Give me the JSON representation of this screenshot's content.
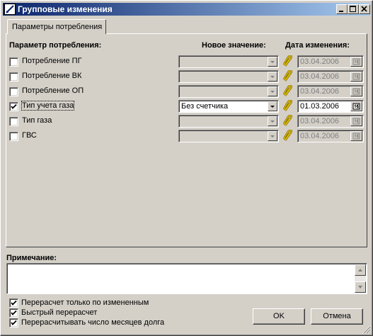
{
  "window": {
    "title": "Групповые изменения"
  },
  "tabs": [
    {
      "label": "Параметры потребления"
    }
  ],
  "headers": {
    "param": "Параметр потребления:",
    "new_value": "Новое значение:",
    "change_date": "Дата изменения:"
  },
  "rows": [
    {
      "label": "Потребление ПГ",
      "checked": false,
      "value": "",
      "date": "03.04.2006",
      "enabled": false
    },
    {
      "label": "Потребление ВК",
      "checked": false,
      "value": "",
      "date": "03.04.2006",
      "enabled": false
    },
    {
      "label": "Потребление ОП",
      "checked": false,
      "value": "",
      "date": "03.04.2006",
      "enabled": false
    },
    {
      "label": "Тип учета газа",
      "checked": true,
      "value": "Без счетчика",
      "date": "01.03.2006",
      "enabled": true
    },
    {
      "label": "Тип газа",
      "checked": false,
      "value": "",
      "date": "03.04.2006",
      "enabled": false
    },
    {
      "label": "ГВС",
      "checked": false,
      "value": "",
      "date": "03.04.2006",
      "enabled": false
    }
  ],
  "note": {
    "label": "Примечание:",
    "value": ""
  },
  "options": [
    {
      "label": "Перерасчет только по измененным",
      "checked": true
    },
    {
      "label": "Быстрый перерасчет",
      "checked": true
    },
    {
      "label": "Перерасчитывать число месяцев долга",
      "checked": true
    }
  ],
  "buttons": {
    "ok": "OK",
    "cancel": "Отмена"
  },
  "icons": {
    "app": "app-icon",
    "minimize": "minimize-icon",
    "maximize": "maximize-icon",
    "close": "close-icon",
    "dropdown": "chevron-down-icon",
    "clip": "paperclip-icon",
    "calendar": "calendar-icon"
  },
  "colors": {
    "title_start": "#0a246a",
    "title_end": "#a6caf0",
    "face": "#d4d0c8",
    "clip": "#d8b800"
  }
}
